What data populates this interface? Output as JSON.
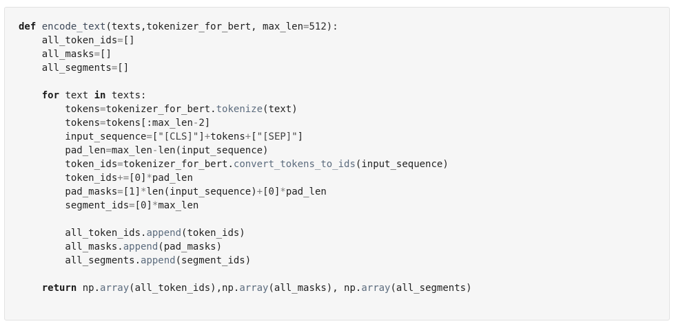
{
  "code": {
    "language": "python",
    "lines": [
      [
        {
          "t": "def",
          "c": "kw"
        },
        {
          "t": " "
        },
        {
          "t": "encode_text",
          "c": "fn"
        },
        {
          "t": "(texts,tokenizer_for_bert, max_len"
        },
        {
          "t": "=",
          "c": "op"
        },
        {
          "t": "512",
          "c": "num"
        },
        {
          "t": "):"
        }
      ],
      [
        {
          "t": "    all_token_ids"
        },
        {
          "t": "=",
          "c": "op"
        },
        {
          "t": "[]"
        }
      ],
      [
        {
          "t": "    all_masks"
        },
        {
          "t": "=",
          "c": "op"
        },
        {
          "t": "[]"
        }
      ],
      [
        {
          "t": "    all_segments"
        },
        {
          "t": "=",
          "c": "op"
        },
        {
          "t": "[]"
        }
      ],
      [],
      [
        {
          "t": "    "
        },
        {
          "t": "for",
          "c": "kw"
        },
        {
          "t": " text "
        },
        {
          "t": "in",
          "c": "kw"
        },
        {
          "t": " texts:"
        }
      ],
      [
        {
          "t": "        tokens"
        },
        {
          "t": "=",
          "c": "op"
        },
        {
          "t": "tokenizer_for_bert."
        },
        {
          "t": "tokenize",
          "c": "method"
        },
        {
          "t": "(text)"
        }
      ],
      [
        {
          "t": "        tokens"
        },
        {
          "t": "=",
          "c": "op"
        },
        {
          "t": "tokens[:max_len"
        },
        {
          "t": "-",
          "c": "op"
        },
        {
          "t": "2",
          "c": "num"
        },
        {
          "t": "]"
        }
      ],
      [
        {
          "t": "        input_sequence"
        },
        {
          "t": "=",
          "c": "op"
        },
        {
          "t": "["
        },
        {
          "t": "\"[CLS]\"",
          "c": "str"
        },
        {
          "t": "]"
        },
        {
          "t": "+",
          "c": "op"
        },
        {
          "t": "tokens"
        },
        {
          "t": "+",
          "c": "op"
        },
        {
          "t": "["
        },
        {
          "t": "\"[SEP]\"",
          "c": "str"
        },
        {
          "t": "]"
        }
      ],
      [
        {
          "t": "        pad_len"
        },
        {
          "t": "=",
          "c": "op"
        },
        {
          "t": "max_len"
        },
        {
          "t": "-",
          "c": "op"
        },
        {
          "t": "len(input_sequence)"
        }
      ],
      [
        {
          "t": "        token_ids"
        },
        {
          "t": "=",
          "c": "op"
        },
        {
          "t": "tokenizer_for_bert."
        },
        {
          "t": "convert_tokens_to_ids",
          "c": "method"
        },
        {
          "t": "(input_sequence)"
        }
      ],
      [
        {
          "t": "        token_ids"
        },
        {
          "t": "+=",
          "c": "op"
        },
        {
          "t": "["
        },
        {
          "t": "0",
          "c": "num"
        },
        {
          "t": "]"
        },
        {
          "t": "*",
          "c": "op"
        },
        {
          "t": "pad_len"
        }
      ],
      [
        {
          "t": "        pad_masks"
        },
        {
          "t": "=",
          "c": "op"
        },
        {
          "t": "["
        },
        {
          "t": "1",
          "c": "num"
        },
        {
          "t": "]"
        },
        {
          "t": "*",
          "c": "op"
        },
        {
          "t": "len(input_sequence)"
        },
        {
          "t": "+",
          "c": "op"
        },
        {
          "t": "["
        },
        {
          "t": "0",
          "c": "num"
        },
        {
          "t": "]"
        },
        {
          "t": "*",
          "c": "op"
        },
        {
          "t": "pad_len"
        }
      ],
      [
        {
          "t": "        segment_ids"
        },
        {
          "t": "=",
          "c": "op"
        },
        {
          "t": "["
        },
        {
          "t": "0",
          "c": "num"
        },
        {
          "t": "]"
        },
        {
          "t": "*",
          "c": "op"
        },
        {
          "t": "max_len"
        }
      ],
      [],
      [
        {
          "t": "        all_token_ids."
        },
        {
          "t": "append",
          "c": "method"
        },
        {
          "t": "(token_ids)"
        }
      ],
      [
        {
          "t": "        all_masks."
        },
        {
          "t": "append",
          "c": "method"
        },
        {
          "t": "(pad_masks)"
        }
      ],
      [
        {
          "t": "        all_segments."
        },
        {
          "t": "append",
          "c": "method"
        },
        {
          "t": "(segment_ids)"
        }
      ],
      [],
      [
        {
          "t": "    "
        },
        {
          "t": "return",
          "c": "kw"
        },
        {
          "t": " np."
        },
        {
          "t": "array",
          "c": "method"
        },
        {
          "t": "(all_token_ids),np."
        },
        {
          "t": "array",
          "c": "method"
        },
        {
          "t": "(all_masks), np."
        },
        {
          "t": "array",
          "c": "method"
        },
        {
          "t": "(all_segments)"
        }
      ]
    ]
  }
}
